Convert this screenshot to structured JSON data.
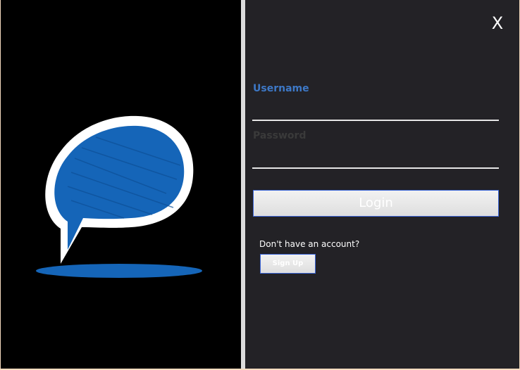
{
  "window": {
    "close_label": "X"
  },
  "logo": {
    "icon": "chat-bubble-icon",
    "fill_color": "#1565b8",
    "outline_color": "#ffffff"
  },
  "login_form": {
    "username_label": "Username",
    "username_value": "",
    "password_label": "Password",
    "password_value": "",
    "login_label": "Login",
    "account_prompt": "Don't have an account?",
    "signup_label": "Sign Up"
  },
  "colors": {
    "accent": "#3d78c6",
    "button_border": "#3c66d8",
    "panel_background": "#232226"
  }
}
